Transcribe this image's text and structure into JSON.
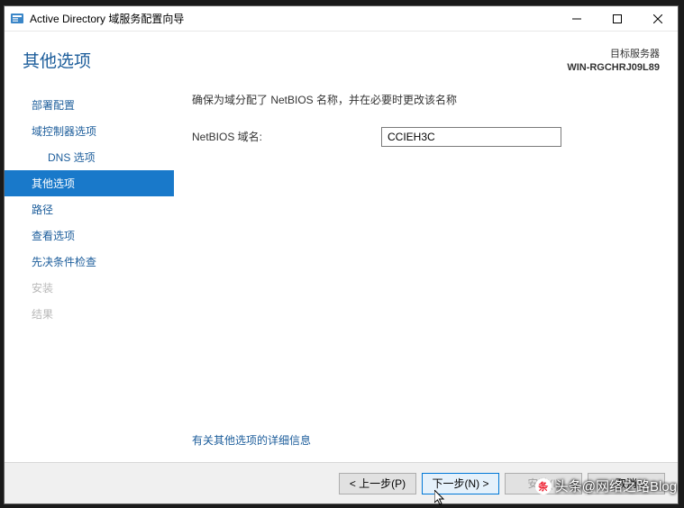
{
  "window": {
    "title": "Active Directory 域服务配置向导"
  },
  "header": {
    "page_title": "其他选项",
    "target_label": "目标服务器",
    "target_server": "WIN-RGCHRJ09L89"
  },
  "sidebar": {
    "items": [
      {
        "label": "部署配置",
        "state": "normal"
      },
      {
        "label": "域控制器选项",
        "state": "normal"
      },
      {
        "label": "DNS 选项",
        "state": "sub"
      },
      {
        "label": "其他选项",
        "state": "active"
      },
      {
        "label": "路径",
        "state": "normal"
      },
      {
        "label": "查看选项",
        "state": "normal"
      },
      {
        "label": "先决条件检查",
        "state": "normal"
      },
      {
        "label": "安装",
        "state": "disabled"
      },
      {
        "label": "结果",
        "state": "disabled"
      }
    ]
  },
  "main": {
    "instruction": "确保为域分配了 NetBIOS 名称，并在必要时更改该名称",
    "netbios_label": "NetBIOS 域名:",
    "netbios_value": "CCIEH3C",
    "more_link": "有关其他选项的详细信息"
  },
  "footer": {
    "prev": "< 上一步(P)",
    "next": "下一步(N) >",
    "install": "安装(I)",
    "cancel": "取消"
  },
  "watermark": "头条@网络之路Blog"
}
